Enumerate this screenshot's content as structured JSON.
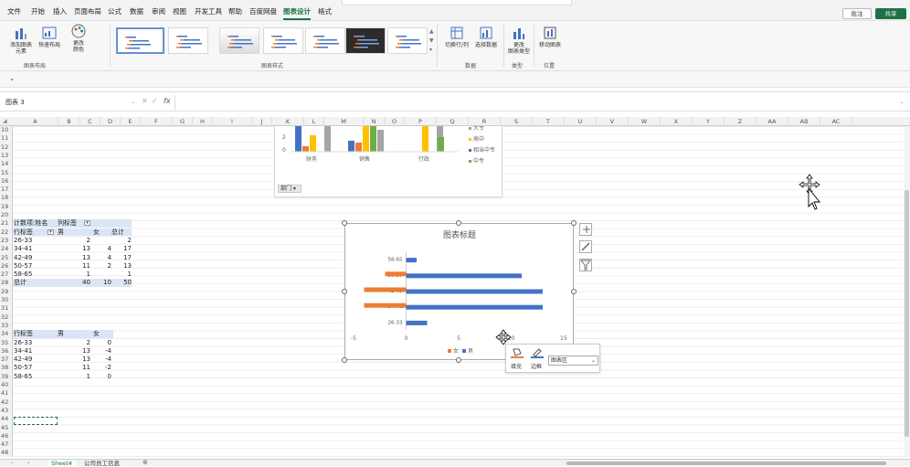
{
  "menu": [
    "文件",
    "开始",
    "插入",
    "页面布局",
    "公式",
    "数据",
    "审阅",
    "视图",
    "开发工具",
    "帮助",
    "百度网盘",
    "图表设计",
    "格式"
  ],
  "menu_active": "图表设计",
  "top_right": {
    "comment": "批注",
    "share": "共享"
  },
  "ribbon": {
    "add_element": "添加图表\n元素",
    "quick_layout": "快速布局",
    "change_color": "更改\n颜色",
    "switch_row_col": "切换行/列",
    "select_data": "选择数据",
    "change_type": "更改\n图表类型",
    "move_chart": "移动图表",
    "groups": {
      "layout": "图表布局",
      "styles": "图表样式",
      "data": "数据",
      "type": "类型",
      "location": "位置"
    }
  },
  "name_box": "图表 3",
  "fx": "fx",
  "columns": [
    "A",
    "B",
    "C",
    "D",
    "E",
    "F",
    "G",
    "H",
    "I",
    "J",
    "K",
    "L",
    "M",
    "N",
    "O",
    "P",
    "Q",
    "R",
    "S",
    "T",
    "U",
    "V",
    "W",
    "X",
    "Y",
    "Z",
    "AA",
    "AB",
    "AC"
  ],
  "rows": [
    "10",
    "11",
    "12",
    "13",
    "14",
    "15",
    "16",
    "17",
    "18",
    "19",
    "20",
    "21",
    "22",
    "23",
    "24",
    "25",
    "26",
    "27",
    "28",
    "29",
    "30",
    "31",
    "32",
    "33",
    "34",
    "35",
    "36",
    "37",
    "38",
    "39",
    "40",
    "41",
    "42",
    "43",
    "44",
    "45",
    "46",
    "47",
    "48"
  ],
  "pivot": {
    "header1": "计数项:姓名",
    "header2": "列标签",
    "rowlabel": "行标签",
    "male": "男",
    "female": "女",
    "total": "总计",
    "rows": [
      {
        "label": "26-33",
        "male": "2",
        "female": "",
        "total": "2"
      },
      {
        "label": "34-41",
        "male": "13",
        "female": "4",
        "total": "17"
      },
      {
        "label": "42-49",
        "male": "13",
        "female": "4",
        "total": "17"
      },
      {
        "label": "50-57",
        "male": "11",
        "female": "2",
        "total": "13"
      },
      {
        "label": "58-65",
        "male": "1",
        "female": "",
        "total": "1"
      }
    ],
    "total_row": {
      "label": "总计",
      "male": "40",
      "female": "10",
      "total": "50"
    }
  },
  "table2": {
    "rowlabel": "行标签",
    "male": "男",
    "female": "女",
    "rows": [
      {
        "label": "26-33",
        "male": "2",
        "female": "0"
      },
      {
        "label": "34-41",
        "male": "13",
        "female": "-4"
      },
      {
        "label": "42-49",
        "male": "13",
        "female": "-4"
      },
      {
        "label": "50-57",
        "male": "11",
        "female": "-2"
      },
      {
        "label": "58-65",
        "male": "1",
        "female": "0"
      }
    ]
  },
  "chart1": {
    "categories": [
      "财务",
      "销售",
      "行政"
    ],
    "legend": [
      "大专",
      "高中",
      "相当中专",
      "中专"
    ],
    "y_ticks": [
      "2",
      "0"
    ],
    "filter_button": "部门"
  },
  "chart_data": {
    "type": "bar",
    "orientation": "horizontal",
    "title": "图表标题",
    "categories": [
      "26-33",
      "34-41",
      "42-49",
      "50-57",
      "58-65"
    ],
    "series": [
      {
        "name": "女",
        "values": [
          0,
          -4,
          -4,
          -2,
          0
        ],
        "color": "#ed7d31"
      },
      {
        "name": "男",
        "values": [
          2,
          13,
          13,
          11,
          1
        ],
        "color": "#4472c4"
      }
    ],
    "xlim": [
      -5,
      15
    ],
    "x_ticks": [
      "-5",
      "0",
      "5",
      "10",
      "15"
    ],
    "legend_position": "bottom"
  },
  "format_popup": {
    "fill": "填充",
    "border": "边框",
    "select": "图表区"
  },
  "sheets": [
    "Sheet4",
    "公司员工信息"
  ],
  "active_sheet": "Sheet4"
}
